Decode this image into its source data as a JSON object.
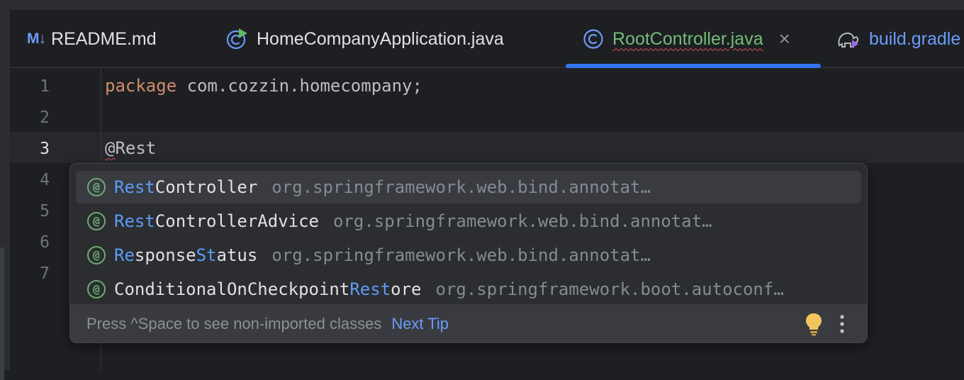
{
  "tabs": [
    {
      "label": "README.md",
      "icon": "markdown-icon",
      "icon_text": "M↓"
    },
    {
      "label": "HomeCompanyApplication.java",
      "icon": "run-class-icon"
    },
    {
      "label": "RootController.java",
      "icon": "class-icon",
      "active": true
    },
    {
      "label": "build.gradle",
      "icon": "gradle-elephant-icon"
    }
  ],
  "editor": {
    "line_numbers": [
      "1",
      "2",
      "3",
      "4",
      "5",
      "6",
      "7"
    ],
    "current_line": "3",
    "lines": {
      "keyword": "package",
      "package_name": "com.cozzin.homecompany;",
      "typed_at": "@",
      "typed_rest": "Rest"
    }
  },
  "completion": {
    "items": [
      {
        "parts": [
          [
            "Rest",
            true
          ],
          [
            "Controller",
            false
          ]
        ],
        "package": "org.springframework.web.bind.annotation",
        "selected": true
      },
      {
        "parts": [
          [
            "Rest",
            true
          ],
          [
            "ControllerAdvice",
            false
          ]
        ],
        "package": "org.springframework.web.bind.annotation"
      },
      {
        "parts": [
          [
            "Re",
            true
          ],
          [
            "sponse",
            false
          ],
          [
            "St",
            true
          ],
          [
            "atus",
            false
          ]
        ],
        "package": "org.springframework.web.bind.annotation"
      },
      {
        "parts": [
          [
            "ConditionalOnCheckpoint",
            false
          ],
          [
            "Rest",
            true
          ],
          [
            "ore",
            false
          ]
        ],
        "package": "org.springframework.boot.autoconf…"
      }
    ],
    "at_symbol": "@",
    "footer_hint": "Press ^Space to see non-imported classes",
    "footer_link": "Next Tip",
    "icons": [
      "annotation-icon",
      "lightbulb-icon",
      "more-options-icon"
    ]
  },
  "colors": {
    "keyword": "#cf8e6d",
    "match": "#5c9cf5",
    "active_tab": "#73bd79",
    "accent": "#3574f0",
    "annotation": "#6aab73"
  }
}
